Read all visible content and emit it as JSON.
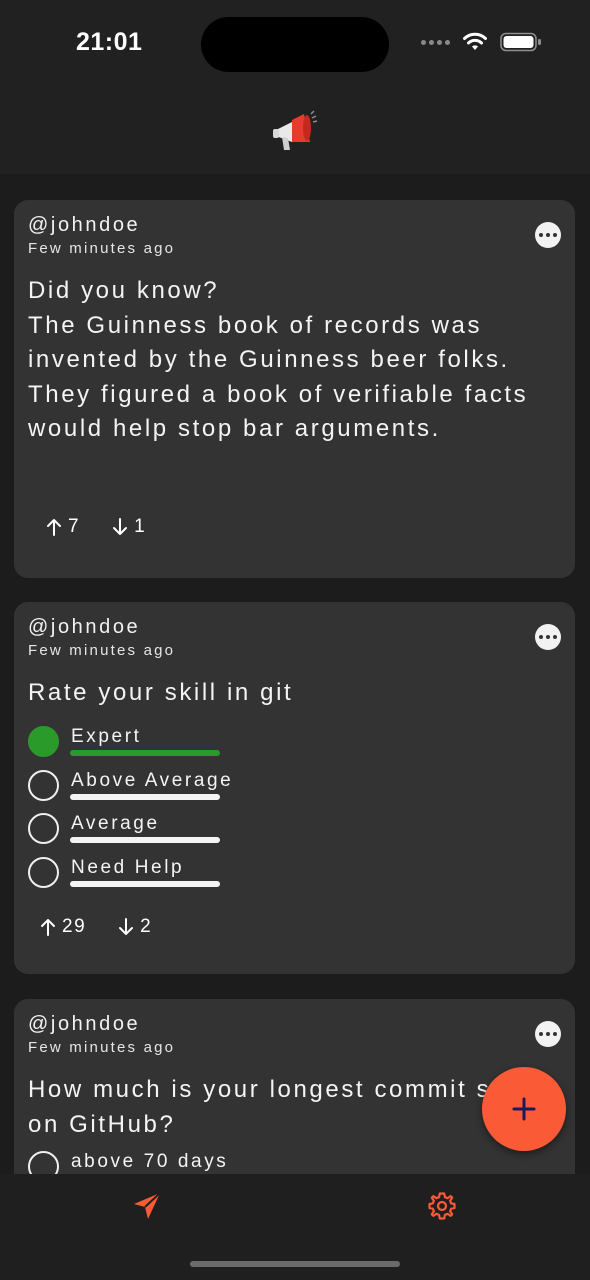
{
  "status_bar": {
    "time": "21:01"
  },
  "header": {
    "logo_icon": "megaphone-icon"
  },
  "posts": [
    {
      "username": "@johndoe",
      "timestamp": "Few minutes ago",
      "text": "Did you know?\nThe Guinness book of records was invented by the Guinness beer folks. They figured a book of verifiable facts would help stop bar arguments.",
      "upvotes": "7",
      "downvotes": "1"
    },
    {
      "username": "@johndoe",
      "timestamp": "Few minutes ago",
      "text": "Rate your skill in git",
      "poll": [
        {
          "label": "Expert",
          "selected": true
        },
        {
          "label": "Above Average",
          "selected": false
        },
        {
          "label": "Average",
          "selected": false
        },
        {
          "label": "Need Help",
          "selected": false
        }
      ],
      "upvotes": "29",
      "downvotes": "2"
    },
    {
      "username": "@johndoe",
      "timestamp": "Few minutes ago",
      "text": "How much is your longest commit streak on GitHub?",
      "poll": [
        {
          "label": "above 70 days",
          "selected": false
        }
      ]
    }
  ],
  "fab": {
    "icon": "plus-icon"
  },
  "bottom_nav": [
    {
      "name": "feed",
      "icon": "send-icon",
      "active": true
    },
    {
      "name": "settings",
      "icon": "gear-icon",
      "active": false
    }
  ],
  "colors": {
    "accent": "#fb5a36",
    "selected_option": "#2a9a2a",
    "card": "#333333",
    "background": "#1c1c1c"
  }
}
